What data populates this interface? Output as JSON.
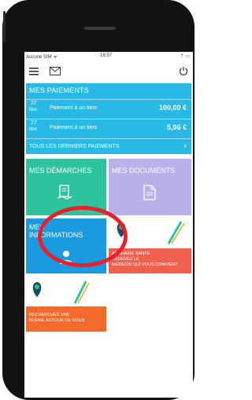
{
  "status_bar": {
    "carrier": "Aucune SIM ᯤ",
    "time": "16:57",
    "battery": "⇡ ▭"
  },
  "payments": {
    "title": "MES PAIEMENTS",
    "rows": [
      {
        "day": "27",
        "month": "févr.",
        "label": "Paiement à un tiers",
        "amount": "100,00 €"
      },
      {
        "day": "27",
        "month": "févr.",
        "label": "Paiement à un tiers",
        "amount": "5,96 €"
      }
    ],
    "all_label": "TOUS LES DERNIERS PAIEMENTS",
    "all_chevron": "›"
  },
  "tiles": {
    "demarches": {
      "label": "MES DÉMARCHES"
    },
    "documents": {
      "label": "MES DOCUMENTS"
    },
    "informations": {
      "label_line1": "MES",
      "label_line2": "INFORMATIONS"
    },
    "annuaire": {
      "line1": "ANNUAIRE SANTÉ",
      "line2": "TROUVEZ LE",
      "line3": "MÉDECIN QUI VOUS CONVIENT"
    },
    "borne": {
      "line1": "RECHERCHEZ UNE",
      "line2": "BORNE AUTOUR DE VOUS"
    }
  },
  "colors": {
    "payments_bg": "#29b9e7",
    "demarches_bg": "#2ec29d",
    "documents_bg": "#b9b2ea",
    "informations_bg": "#1c9ae0",
    "annuaire_band": "#f0604f",
    "borne_band": "#f36a2c",
    "highlight": "#e8202a"
  },
  "icons": {
    "menu": "hamburger-icon",
    "mail": "envelope-icon",
    "power": "power-icon",
    "demarches": "document-hand-icon",
    "documents": "document-icon",
    "informations": "person-icon",
    "map_pin": "map-pin-icon"
  }
}
